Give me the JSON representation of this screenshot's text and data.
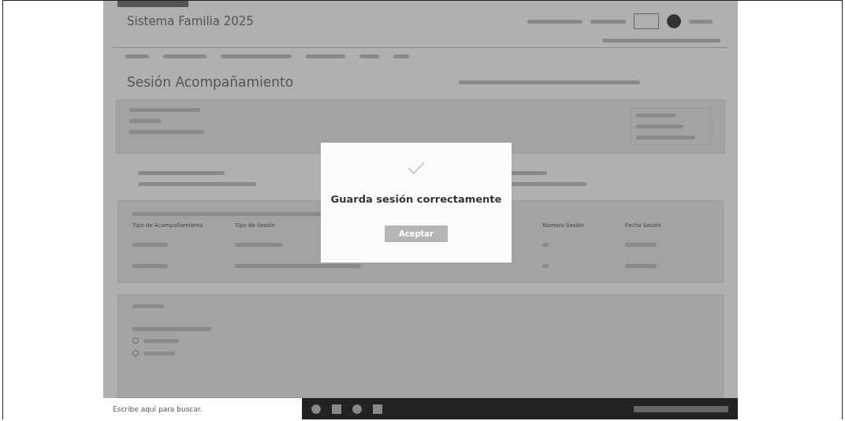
{
  "app": {
    "title": "Sistema Familia 2025"
  },
  "page": {
    "title": "Sesión Acompañamiento"
  },
  "sessions_table": {
    "columns": [
      "Tipo de Acompañamiento",
      "Tipo de Sesión",
      "Número Sesión",
      "Fecha Sesión"
    ]
  },
  "form_options": [
    {
      "selected": false
    },
    {
      "selected": false
    }
  ],
  "dialog": {
    "message": "Guarda sesión correctamente",
    "button": "Aceptar"
  },
  "taskbar": {
    "search_placeholder": "Escribe aquí para buscar."
  }
}
